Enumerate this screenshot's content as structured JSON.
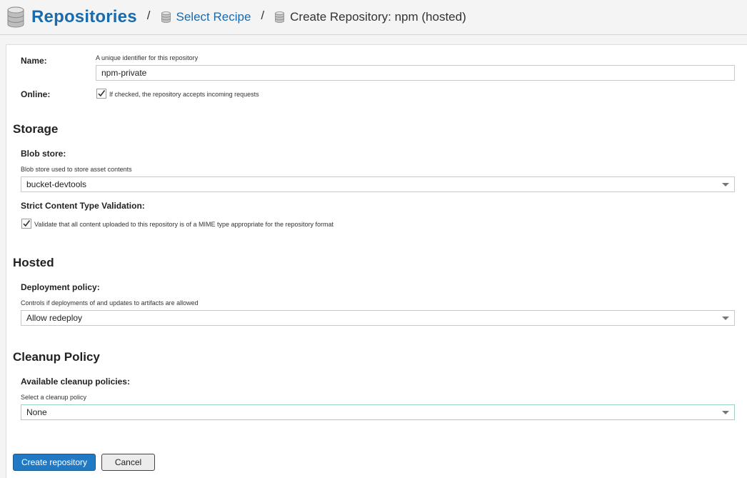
{
  "breadcrumb": {
    "root": "Repositories",
    "separator": "/",
    "link": "Select Recipe",
    "current": "Create Repository: npm (hosted)"
  },
  "form": {
    "name": {
      "label": "Name:",
      "help": "A unique identifier for this repository",
      "value": "npm-private"
    },
    "online": {
      "label": "Online:",
      "checked": true,
      "text": "If checked, the repository accepts incoming requests"
    },
    "storage": {
      "heading": "Storage",
      "blob_label": "Blob store:",
      "blob_help": "Blob store used to store asset contents",
      "blob_value": "bucket-devtools",
      "strict_label": "Strict Content Type Validation:",
      "strict_checked": true,
      "strict_text": "Validate that all content uploaded to this repository is of a MIME type appropriate for the repository format"
    },
    "hosted": {
      "heading": "Hosted",
      "deploy_label": "Deployment policy:",
      "deploy_help": "Controls if deployments of and updates to artifacts are allowed",
      "deploy_value": "Allow redeploy"
    },
    "cleanup": {
      "heading": "Cleanup Policy",
      "available_label": "Available cleanup policies:",
      "select_help": "Select a cleanup policy",
      "value": "None"
    }
  },
  "buttons": {
    "create": "Create repository",
    "cancel": "Cancel"
  },
  "colors": {
    "accent": "#1a6aac",
    "primary_button": "#2179c4",
    "focus_border": "#9dd1c8"
  },
  "icons": {
    "repository": "database-icon",
    "dropdown": "chevron-down-icon",
    "checkbox": "checkmark-icon"
  }
}
